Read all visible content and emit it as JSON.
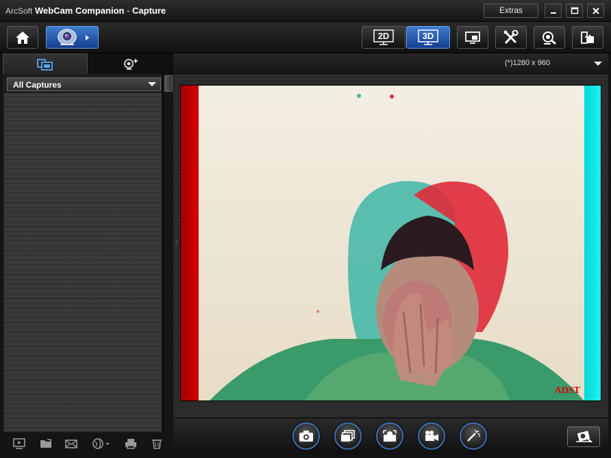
{
  "window": {
    "brand": "ArcSoft",
    "app_name": "WebCam Companion",
    "separator": " - ",
    "section": "Capture",
    "extras_label": "Extras"
  },
  "toolbar": {
    "mode_2d_label": "2D",
    "mode_3d_label": "3D",
    "active_mode": "3D"
  },
  "left_panel": {
    "filter_value": "All Captures"
  },
  "preview": {
    "resolution": "(*)1280 x 960",
    "watermark": "ADST"
  },
  "colors": {
    "accent_blue": "#2f6fd0",
    "anaglyph_red": "#d40000",
    "anaglyph_cyan": "#20f0ef"
  }
}
